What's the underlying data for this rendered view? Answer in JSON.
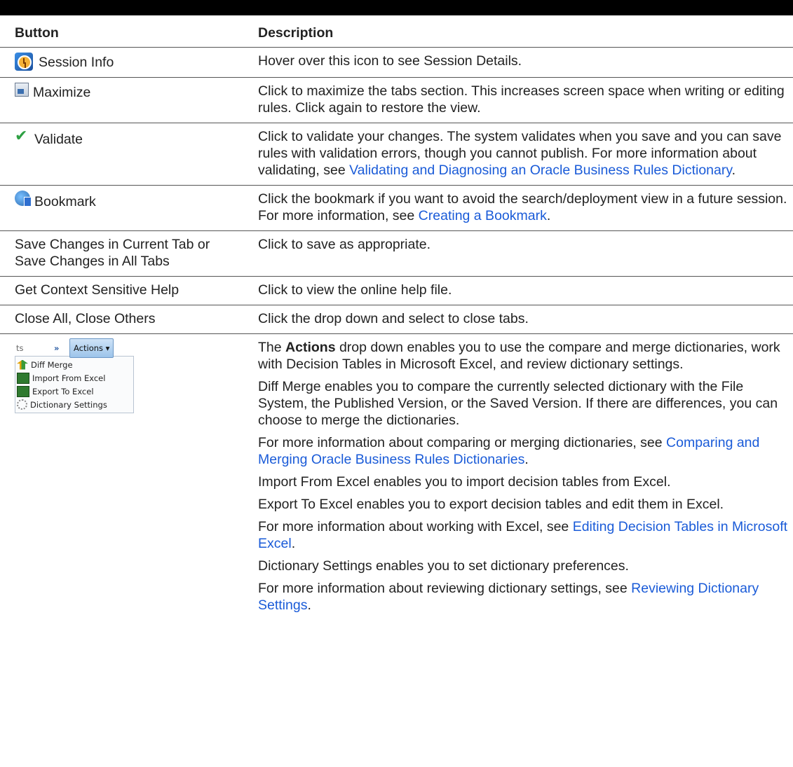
{
  "header": {
    "col_button": "Button",
    "col_description": "Description"
  },
  "rows": [
    {
      "button": "Session Info",
      "icon": "session-info-icon",
      "description": "Hover over this icon to see Session Details."
    },
    {
      "button": "Maximize",
      "icon": "maximize-icon",
      "description": "Click to maximize the tabs section. This increases screen space when writing or editing rules. Click again to restore the view."
    },
    {
      "button": "Validate",
      "icon": "validate-check-icon",
      "description_pre": "Click to validate your changes. The system validates when you save and you can save rules with validation errors, though you cannot publish. For more information about validating, see ",
      "description_link": "Validating and Diagnosing an Oracle Business Rules Dictionary",
      "description_post": "."
    },
    {
      "button": "Bookmark",
      "icon": "bookmark-globe-icon",
      "description_pre": "Click the bookmark if you want to avoid the search/deployment view in a future session. For more information, see ",
      "description_link": "Creating a Bookmark",
      "description_post": "."
    },
    {
      "button": "Save Changes in Current Tab or Save Changes in All Tabs",
      "description": "Click to save as appropriate."
    },
    {
      "button": "Get Context Sensitive Help",
      "description": "Click to view the online help file."
    },
    {
      "button": "Close All, Close Others",
      "description": "Click the drop down and select to close tabs."
    }
  ],
  "actions_row": {
    "screenshot": {
      "tab_fragment": "ts",
      "chevron": "»",
      "button_label": "Actions ▾",
      "menu_items": [
        "Diff Merge",
        "Import From Excel",
        "Export To Excel",
        "Dictionary Settings"
      ]
    },
    "p1_pre": "The ",
    "p1_bold": "Actions",
    "p1_post": " drop down enables you to use the compare and merge dictionaries, work with Decision Tables in Microsoft Excel, and review dictionary settings.",
    "p2": "Diff Merge enables you to compare the currently selected dictionary with the File System, the Published Version, or the Saved Version. If there are differences, you can choose to merge the dictionaries.",
    "p3_pre": "For more information about comparing or merging dictionaries, see ",
    "p3_link": "Comparing and Merging Oracle Business Rules Dictionaries",
    "p3_post": ".",
    "p4": "Import From Excel enables you to import decision tables from Excel.",
    "p5": "Export To Excel enables you to export decision tables and edit them in Excel.",
    "p6_pre": "For more information about working with Excel, see ",
    "p6_link": "Editing Decision Tables in Microsoft Excel",
    "p6_post": ".",
    "p7": "Dictionary Settings enables you to set dictionary preferences.",
    "p8_pre": "For more information about reviewing dictionary settings, see ",
    "p8_link": "Reviewing Dictionary Settings",
    "p8_post": "."
  },
  "colors": {
    "link": "#1a5bd8",
    "text": "#222222",
    "rule": "#555555"
  }
}
